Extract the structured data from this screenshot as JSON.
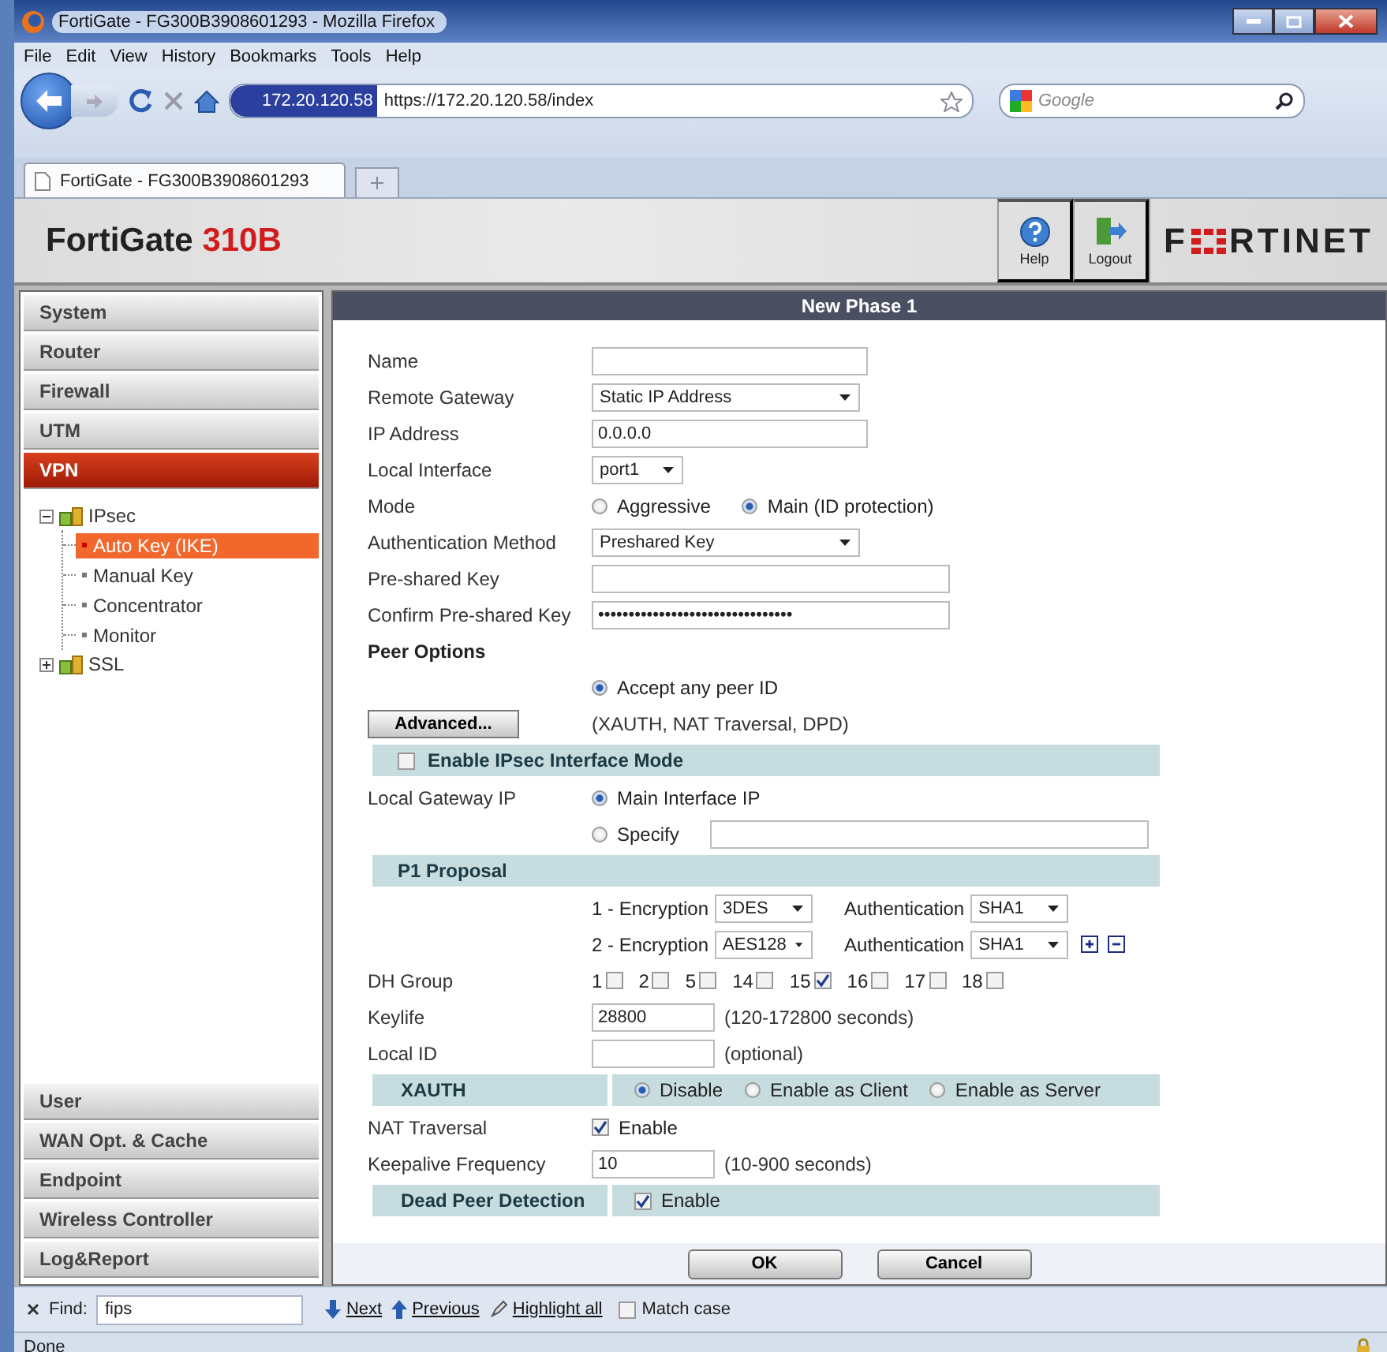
{
  "window": {
    "title": "FortiGate - FG300B3908601293 - Mozilla Firefox"
  },
  "menu": [
    "File",
    "Edit",
    "View",
    "History",
    "Bookmarks",
    "Tools",
    "Help"
  ],
  "toolbar": {
    "site_identity": "172.20.120.58",
    "url": "https://172.20.120.58/index",
    "search_placeholder": "Google"
  },
  "tabs": [
    {
      "label": "FortiGate - FG300B3908601293",
      "selected": true
    }
  ],
  "header": {
    "product": "FortiGate",
    "model": "310B",
    "buttons": [
      {
        "label": "Help",
        "kind": "help"
      },
      {
        "label": "Logout",
        "kind": "logout"
      }
    ],
    "logo_start": "F",
    "logo_end": "RTINET"
  },
  "sidebar": {
    "sections_top": [
      {
        "label": "System",
        "selected": false
      },
      {
        "label": "Router",
        "selected": false
      },
      {
        "label": "Firewall",
        "selected": false
      },
      {
        "label": "UTM",
        "selected": false
      },
      {
        "label": "VPN",
        "selected": true
      }
    ],
    "tree": [
      {
        "label": "IPsec",
        "expanded": true,
        "children": [
          {
            "label": "Auto Key (IKE)",
            "selected": true
          },
          {
            "label": "Manual Key",
            "selected": false
          },
          {
            "label": "Concentrator",
            "selected": false
          },
          {
            "label": "Monitor",
            "selected": false
          }
        ]
      },
      {
        "label": "SSL",
        "expanded": false
      }
    ],
    "sections_bottom": [
      {
        "label": "User",
        "selected": false
      },
      {
        "label": "WAN Opt. & Cache",
        "selected": false
      },
      {
        "label": "Endpoint",
        "selected": false
      },
      {
        "label": "Wireless Controller",
        "selected": false
      },
      {
        "label": "Log&Report",
        "selected": false
      }
    ]
  },
  "form": {
    "title": "New Phase 1",
    "rows": [
      {
        "kind": "text",
        "label": "Name"
      },
      {
        "kind": "select",
        "label": "Remote Gateway",
        "value": "Static IP Address"
      },
      {
        "kind": "text",
        "label": "IP Address",
        "value": "0.0.0.0"
      },
      {
        "kind": "select",
        "label": "Local Interface",
        "value": "port1"
      },
      {
        "kind": "radios",
        "label": "Mode",
        "options": [
          {
            "label": "Aggressive",
            "selected": false
          },
          {
            "label": "Main (ID protection)",
            "selected": true
          }
        ]
      },
      {
        "kind": "select",
        "label": "Authentication Method",
        "value": "Preshared Key"
      },
      {
        "kind": "key",
        "label": "Pre-shared Key"
      },
      {
        "kind": "key",
        "label": "Confirm Pre-shared Key",
        "value": "••••••••••••••••••••••••••••••••"
      },
      {
        "kind": "heading",
        "label": "Peer Options"
      },
      {
        "kind": "radios",
        "options": [
          {
            "label": "Accept any peer ID",
            "selected": true
          }
        ]
      },
      {
        "kind": "button",
        "label": "Advanced...",
        "note": "(XAUTH, NAT Traversal, DPD)"
      },
      {
        "kind": "section_check",
        "label": "Enable IPsec Interface Mode",
        "checked": false
      },
      {
        "kind": "radios",
        "label": "Local Gateway IP",
        "options": [
          {
            "label": "Main Interface IP",
            "selected": true
          }
        ]
      },
      {
        "kind": "radio_field",
        "options": [
          {
            "label": "Specify",
            "selected": false
          }
        ]
      },
      {
        "kind": "section",
        "label": "P1 Proposal"
      },
      {
        "kind": "proposal",
        "label": "1 - Encryption",
        "value": "3DES",
        "auth_label": "Authentication",
        "auth_value": "SHA1"
      },
      {
        "kind": "proposal",
        "label": "2 - Encryption",
        "value": "AES128",
        "auth_label": "Authentication",
        "auth_value": "SHA1"
      },
      {
        "kind": "dh",
        "label": "DH Group",
        "groups": [
          {
            "label": "1",
            "checked": false
          },
          {
            "label": "2",
            "checked": false
          },
          {
            "label": "5",
            "checked": false
          },
          {
            "label": "14",
            "checked": false
          },
          {
            "label": "15",
            "checked": true
          },
          {
            "label": "16",
            "checked": false
          },
          {
            "label": "17",
            "checked": false
          },
          {
            "label": "18",
            "checked": false
          }
        ]
      },
      {
        "kind": "short",
        "label": "Keylife",
        "value": "28800",
        "note": "(120-172800 seconds)"
      },
      {
        "kind": "short",
        "label": "Local ID",
        "note": "(optional)"
      },
      {
        "kind": "section_radios",
        "label": "XAUTH",
        "options": [
          {
            "label": "Disable",
            "selected": true
          },
          {
            "label": "Enable as Client",
            "selected": false
          },
          {
            "label": "Enable as Server",
            "selected": false
          }
        ]
      },
      {
        "kind": "check",
        "label": "NAT Traversal",
        "option": "Enable",
        "checked": true
      },
      {
        "kind": "short",
        "label": "Keepalive Frequency",
        "value": "10",
        "note": "(10-900 seconds)"
      },
      {
        "kind": "section_check2",
        "label": "Dead Peer Detection",
        "option": "Enable",
        "checked": true
      }
    ],
    "buttons": [
      "OK",
      "Cancel"
    ]
  },
  "find_bar": {
    "label": "Find:",
    "value": "fips",
    "buttons": [
      {
        "label": "Next",
        "kind": "down"
      },
      {
        "label": "Previous",
        "kind": "up"
      },
      {
        "label": "Highlight all",
        "kind": "highlight"
      }
    ],
    "match_case": {
      "label": "Match case",
      "checked": false
    }
  },
  "status_bar": {
    "text": "Done"
  }
}
